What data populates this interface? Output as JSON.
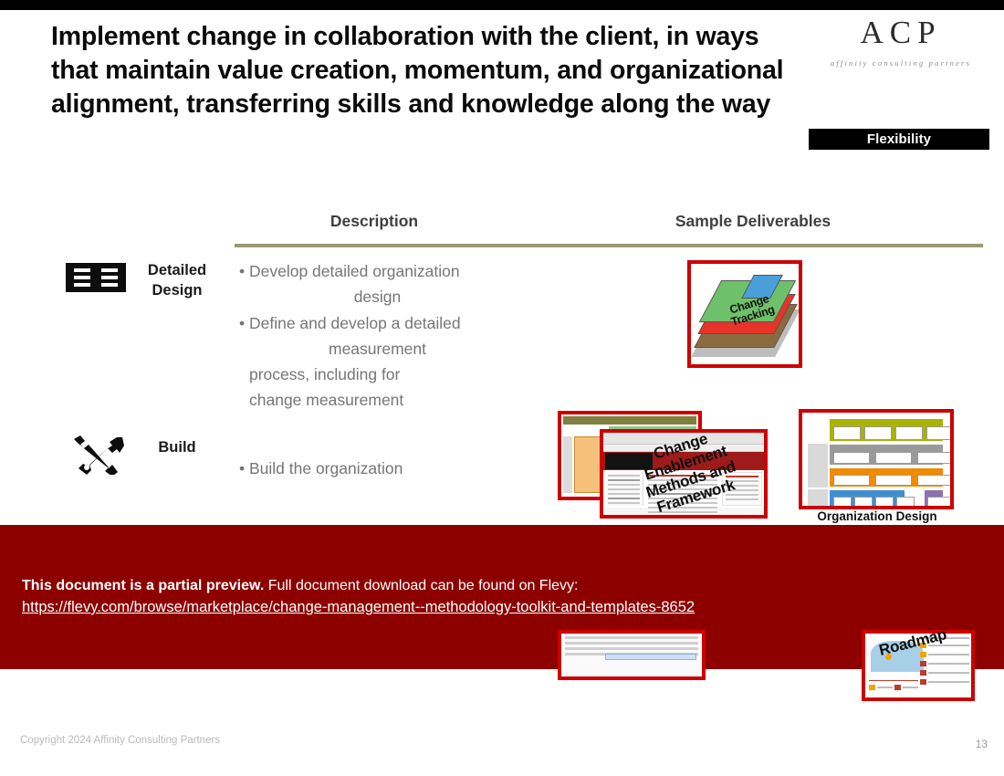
{
  "slide": {
    "title": "Implement change in collaboration with the client, in  ways that maintain value creation, momentum, and organizational alignment, transferring skills and  knowledge along the way",
    "page_number": "13",
    "copyright": "Copyright 2024 Affinity Consulting Partners",
    "accent_olive": "#9a9878",
    "accent_red": "#8c0000",
    "frame_red": "#cc0000"
  },
  "logo": {
    "mark": "ACP",
    "tagline": "affinity consulting partners"
  },
  "badge": {
    "label": "Flexibility"
  },
  "table": {
    "headers": {
      "description": "Description",
      "deliverables": "Sample Deliverables"
    },
    "rows": [
      {
        "label": "Detailed Design",
        "icon": "list-grid-icon",
        "bullets": [
          "• Develop detailed organization",
          "design",
          "• Define and develop a detailed",
          "measurement",
          "process, including          for",
          "change measurement"
        ]
      },
      {
        "label": "Build",
        "icon": "hammer-wrench-icon",
        "bullets": [
          "• Build the organization"
        ]
      }
    ]
  },
  "deliverables": {
    "change_tracking": {
      "label": "Change Tracking",
      "caption": ""
    },
    "change_enablement": {
      "label": "Change Enablement Methods and Framework",
      "caption": ""
    },
    "organization_design": {
      "label": "",
      "caption": "Organization Design"
    },
    "roadmap_partial": {
      "label": "Roadmap",
      "caption": ""
    }
  },
  "preview_banner": {
    "line1_bold": "This document is a partial preview.",
    "line1_rest": "  Full document download can be found on Flevy:",
    "url": "https://flevy.com/browse/marketplace/change-management--methodology-toolkit-and-templates-8652"
  }
}
